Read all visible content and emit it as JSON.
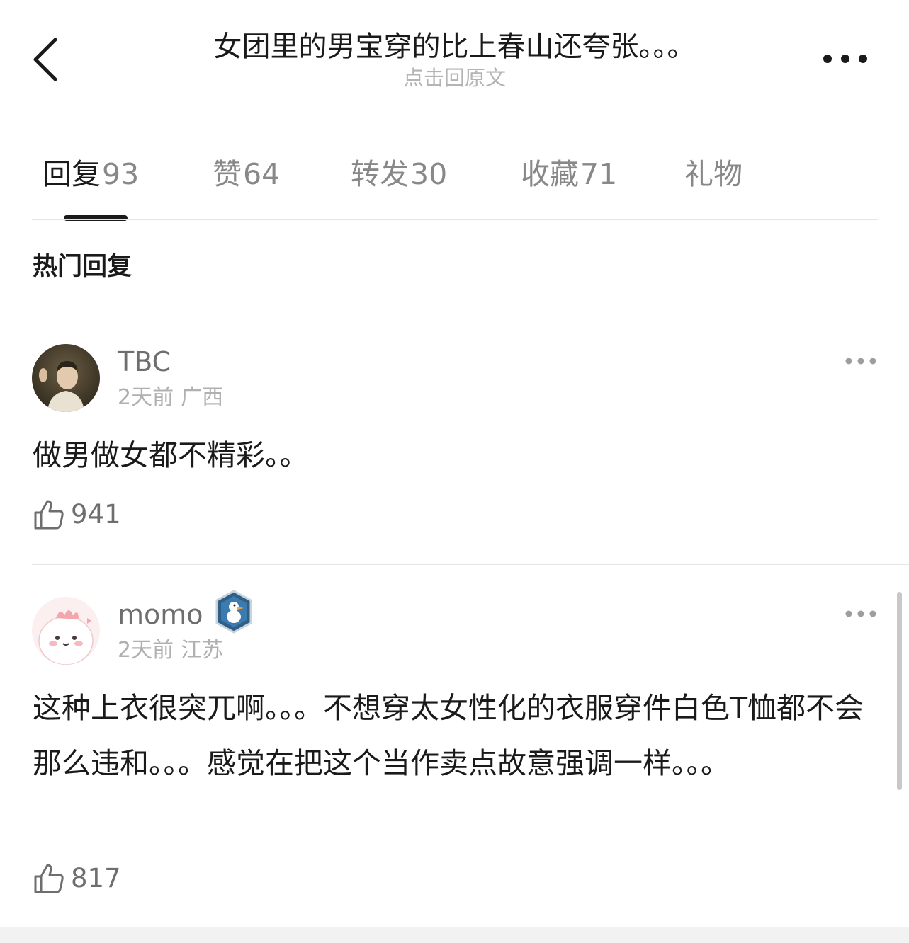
{
  "header": {
    "title": "女团里的男宝穿的比上春山还夸张。。。",
    "subtitle": "点击回原文"
  },
  "tabs": [
    {
      "label": "回复",
      "count": "93"
    },
    {
      "label": "赞",
      "count": "64"
    },
    {
      "label": "转发",
      "count": "30"
    },
    {
      "label": "收藏",
      "count": "71"
    },
    {
      "label": "礼物",
      "count": ""
    }
  ],
  "section_title": "热门回复",
  "comments": [
    {
      "username": "TBC",
      "time": "2天前",
      "location": "广西",
      "text": "做男做女都不精彩。。",
      "likes": "941"
    },
    {
      "username": "momo",
      "time": "2天前",
      "location": "江苏",
      "text": "这种上衣很突兀啊。。。不想穿太女性化的衣服穿件白色T恤都不会那么违和。。。感觉在把这个当作卖点故意强调一样。。。",
      "likes": "817"
    }
  ],
  "icons": {
    "back": "chevron-left-icon",
    "more": "more-horizontal-icon",
    "like": "thumbs-up-icon",
    "badge": "duck-badge-icon"
  },
  "colors": {
    "text_primary": "#1a1a1a",
    "text_secondary": "#888888",
    "text_tertiary": "#b0b0b0",
    "divider": "#e6e6e6"
  }
}
